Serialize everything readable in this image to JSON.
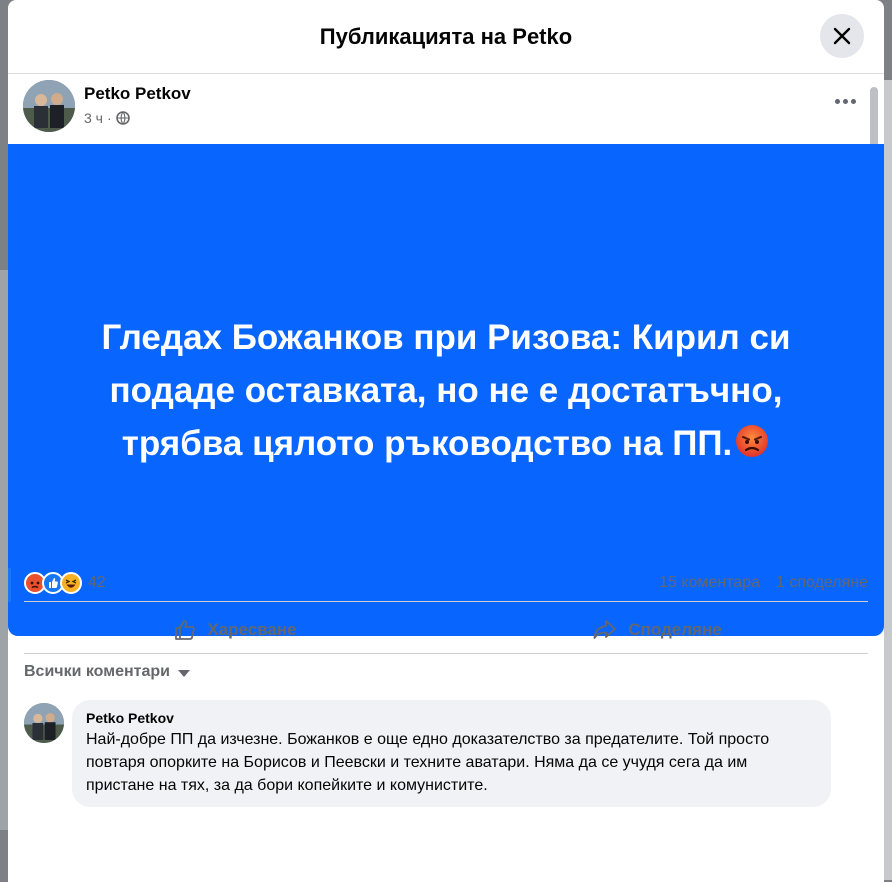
{
  "modal": {
    "title": "Публикацията на Petko"
  },
  "post": {
    "author": "Petko Petkov",
    "time": "3 ч",
    "separator": "·",
    "text": "Гледах Божанков при Ризова: Кирил си подаде оставката, но не е достатъчно, трябва цялото ръководство на ПП.",
    "background_color": "#0866ff"
  },
  "stats": {
    "reaction_icons": [
      "angry-react-icon",
      "like-react-icon",
      "haha-react-icon"
    ],
    "reaction_count": "42",
    "comments": "15 коментара",
    "shares": "1 споделяне"
  },
  "actions": {
    "like_label": "Харесване",
    "share_label": "Споделяне"
  },
  "comments_section": {
    "sort_label": "Всички коментари",
    "items": [
      {
        "author": "Petko Petkov",
        "text": "Най-добре ПП да изчезне. Божанков е още едно доказателство за предателите. Той просто повтаря опорките на Борисов и Пеевски и техните аватари. Няма да се учудя сега да им пристане на тях, за да бори копейките и комунистите."
      }
    ]
  }
}
